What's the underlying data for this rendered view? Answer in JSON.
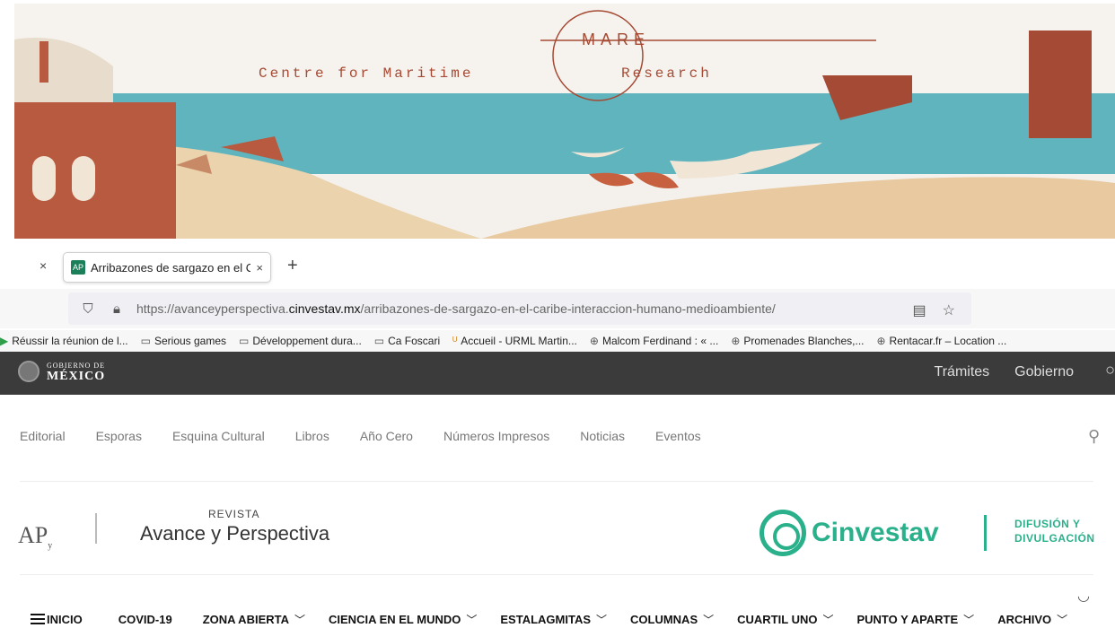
{
  "banner": {
    "org_left": "Centre for Maritime",
    "logo_mark": "MARE",
    "org_right": "Research"
  },
  "browser": {
    "tab_title": "Arribazones de sargazo en el C",
    "tab_close": "×",
    "new_tab": "+",
    "url_prefix": "https://avanceyperspectiva.",
    "url_domain": "cinvestav.mx",
    "url_path": "/arribazones-de-sargazo-en-el-caribe-interaccion-humano-medioambiente/",
    "bookmarks": [
      {
        "label": "Réussir la réunion de l...",
        "icon": "arrow-icon"
      },
      {
        "label": "Serious games",
        "icon": "folder-icon"
      },
      {
        "label": "Développement dura...",
        "icon": "folder-icon"
      },
      {
        "label": "Ca Foscari",
        "icon": "folder-icon"
      },
      {
        "label": "Accueil - URML Martin...",
        "icon": "urml-icon"
      },
      {
        "label": "Malcom Ferdinand : « ...",
        "icon": "globe-icon"
      },
      {
        "label": "Promenades Blanches,...",
        "icon": "globe-icon"
      },
      {
        "label": "Rentacar.fr – Location ...",
        "icon": "globe-icon"
      }
    ]
  },
  "gov": {
    "logo_top": "GOBIERNO DE",
    "logo_bottom": "MÉXICO",
    "links": [
      "Trámites",
      "Gobierno"
    ]
  },
  "secondary_nav": [
    "Editorial",
    "Esporas",
    "Esquina Cultural",
    "Libros",
    "Año Cero",
    "Números Impresos",
    "Noticias",
    "Eventos"
  ],
  "brand": {
    "ap_logo": "AP",
    "ap_sub": "y",
    "revista_small": "REVISTA",
    "revista_name": "Avance y Perspectiva",
    "cinvestav": "Cinvestav",
    "difusion_1": "DIFUSIÓN Y",
    "difusion_2": "DIVULGACIÓN"
  },
  "main_nav": [
    {
      "label": "INICIO",
      "dropdown": false
    },
    {
      "label": "COVID-19",
      "dropdown": false
    },
    {
      "label": "ZONA ABIERTA",
      "dropdown": true
    },
    {
      "label": "CIENCIA EN EL MUNDO",
      "dropdown": true
    },
    {
      "label": "ESTALAGMITAS",
      "dropdown": true
    },
    {
      "label": "COLUMNAS",
      "dropdown": true
    },
    {
      "label": "CUARTIL UNO",
      "dropdown": true
    },
    {
      "label": "PUNTO Y APARTE",
      "dropdown": true
    },
    {
      "label": "ARCHIVO",
      "dropdown": true
    }
  ],
  "colors": {
    "accent": "#2ab08a",
    "gov_bar": "#3b3b3b",
    "banner_rust": "#a54a34",
    "banner_sea": "#5fb4bd"
  }
}
